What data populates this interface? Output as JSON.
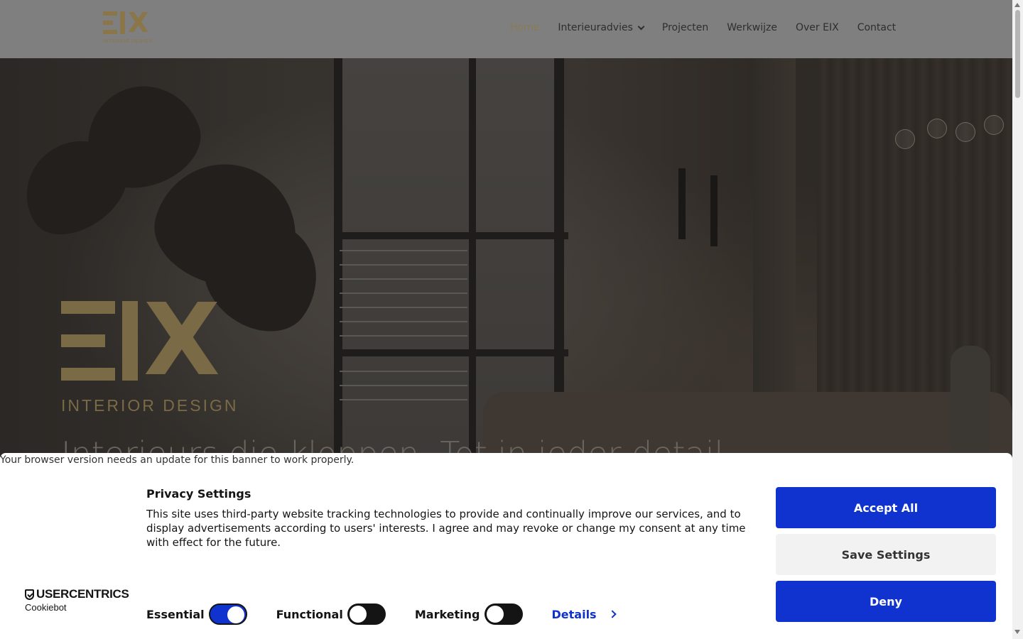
{
  "header": {
    "logo_text": "EIX",
    "logo_subtitle": "INTERIOR DESIGN",
    "nav": [
      {
        "label": "Home",
        "active": true
      },
      {
        "label": "Interieuradvies",
        "has_dropdown": true
      },
      {
        "label": "Projecten"
      },
      {
        "label": "Werkwijze"
      },
      {
        "label": "Over EIX"
      },
      {
        "label": "Contact"
      }
    ]
  },
  "hero": {
    "logo_text": "EIX",
    "logo_subtitle": "INTERIOR DESIGN",
    "tagline": "Interieurs die kloppen. Tot in ieder detail"
  },
  "cookie_banner": {
    "browser_warning": "Your browser version needs an update for this banner to work properly.",
    "title": "Privacy Settings",
    "text": "This site uses third-party website tracking technologies to provide and continually improve our services, and to display advertisements according to users' interests. I agree and may revoke or change my consent at any time with effect for the future.",
    "brand": "USERCENTRICS",
    "brand_sub": "Cookiebot",
    "toggles": [
      {
        "label": "Essential",
        "on": true
      },
      {
        "label": "Functional",
        "on": false
      },
      {
        "label": "Marketing",
        "on": false
      }
    ],
    "details_label": "Details",
    "buttons": {
      "accept": "Accept All",
      "save": "Save Settings",
      "deny": "Deny"
    }
  },
  "colors": {
    "accent_blue": "#1032cf",
    "logo_gold": "#8a7648",
    "nav_active": "#8a7b57"
  }
}
